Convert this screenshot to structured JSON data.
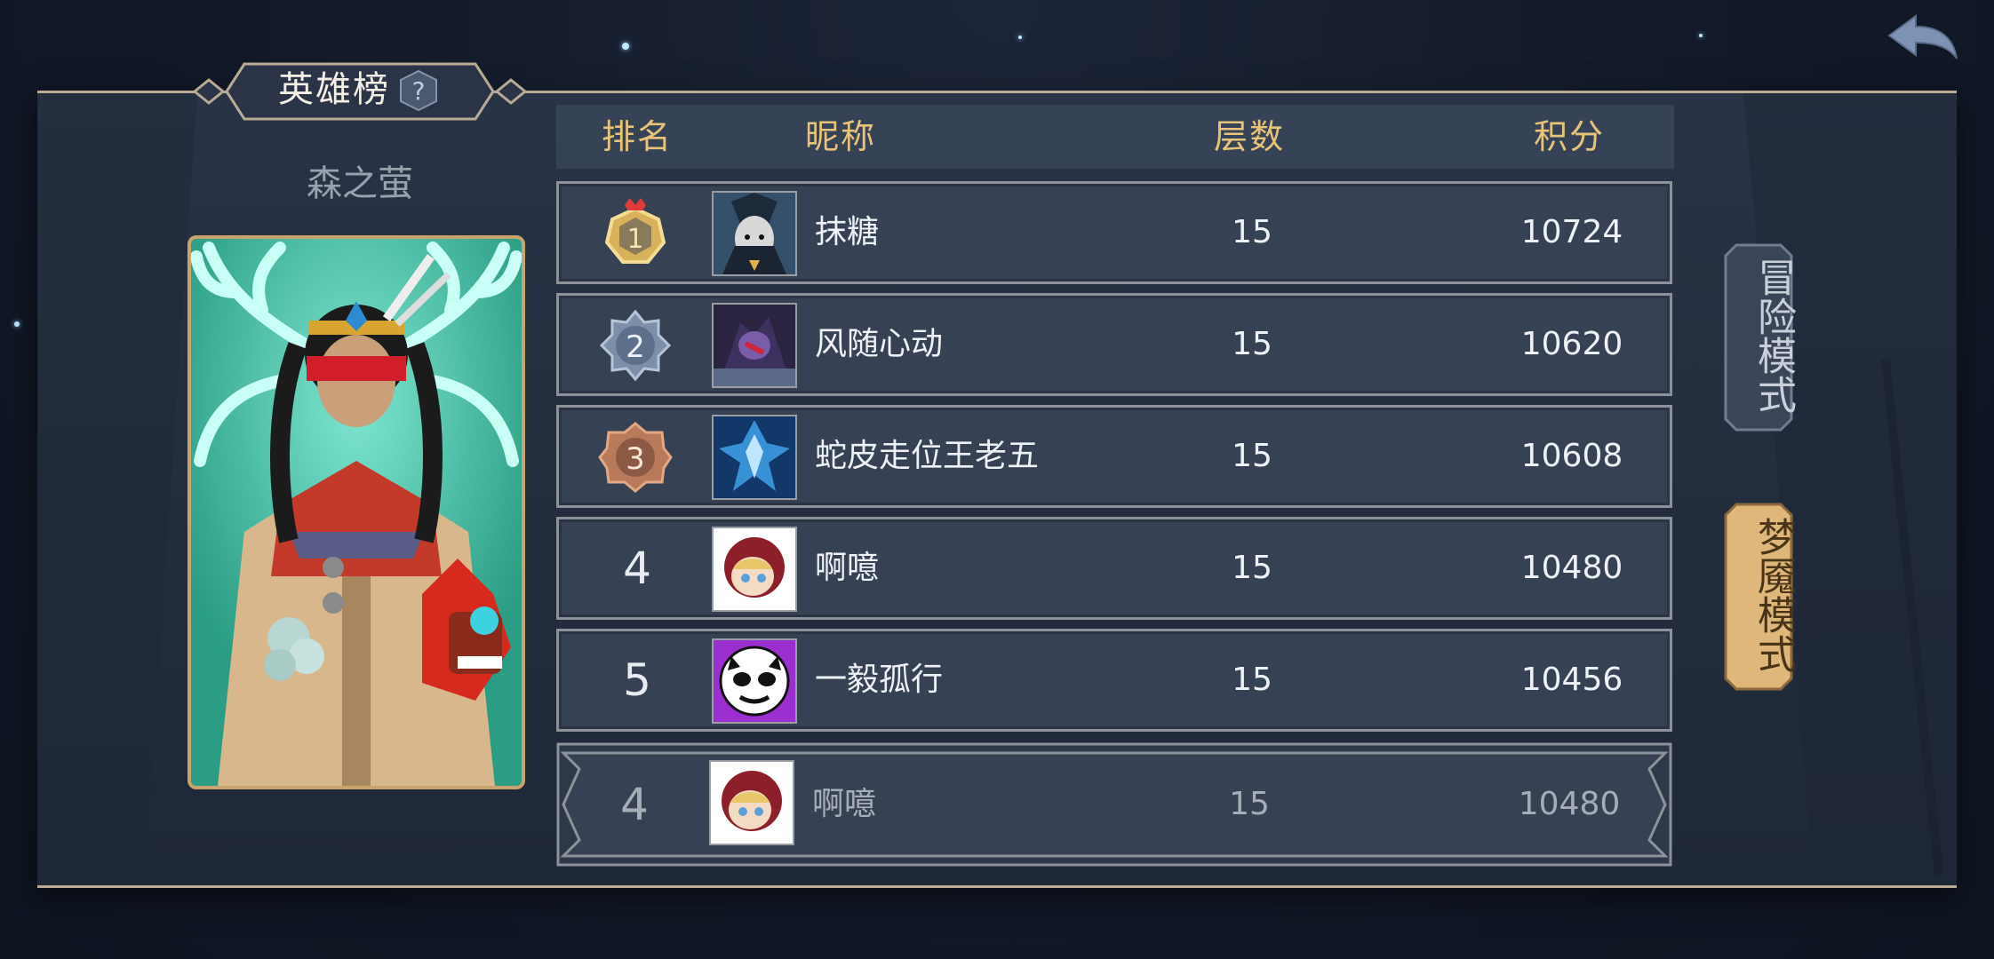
{
  "title": "英雄榜",
  "hero_name": "森之萤",
  "columns": {
    "rank": "排名",
    "nickname": "昵称",
    "floors": "层数",
    "score": "积分"
  },
  "rows": [
    {
      "rank": "1",
      "nickname": "抹糖",
      "floors": "15",
      "score": "10724",
      "badge": "gold",
      "avatar": "wolf-mage"
    },
    {
      "rank": "2",
      "nickname": "风随心动",
      "floors": "15",
      "score": "10620",
      "badge": "silver",
      "avatar": "dark-beast"
    },
    {
      "rank": "3",
      "nickname": "蛇皮走位王老五",
      "floors": "15",
      "score": "10608",
      "badge": "bronze",
      "avatar": "ice-crystal"
    },
    {
      "rank": "4",
      "nickname": "啊噫",
      "floors": "15",
      "score": "10480",
      "badge": "none",
      "avatar": "red-hood-girl"
    },
    {
      "rank": "5",
      "nickname": "一毅孤行",
      "floors": "15",
      "score": "10456",
      "badge": "none",
      "avatar": "panda-face"
    }
  ],
  "self": {
    "rank": "4",
    "nickname": "啊噫",
    "floors": "15",
    "score": "10480",
    "avatar": "red-hood-girl"
  },
  "modes": [
    {
      "label": "冒险模式",
      "active": false
    },
    {
      "label": "梦魇模式",
      "active": true
    }
  ],
  "colors": {
    "gold": "#e8c47a",
    "panel": "#283446",
    "row": "#364254",
    "active_tab": "#e0b77a"
  }
}
